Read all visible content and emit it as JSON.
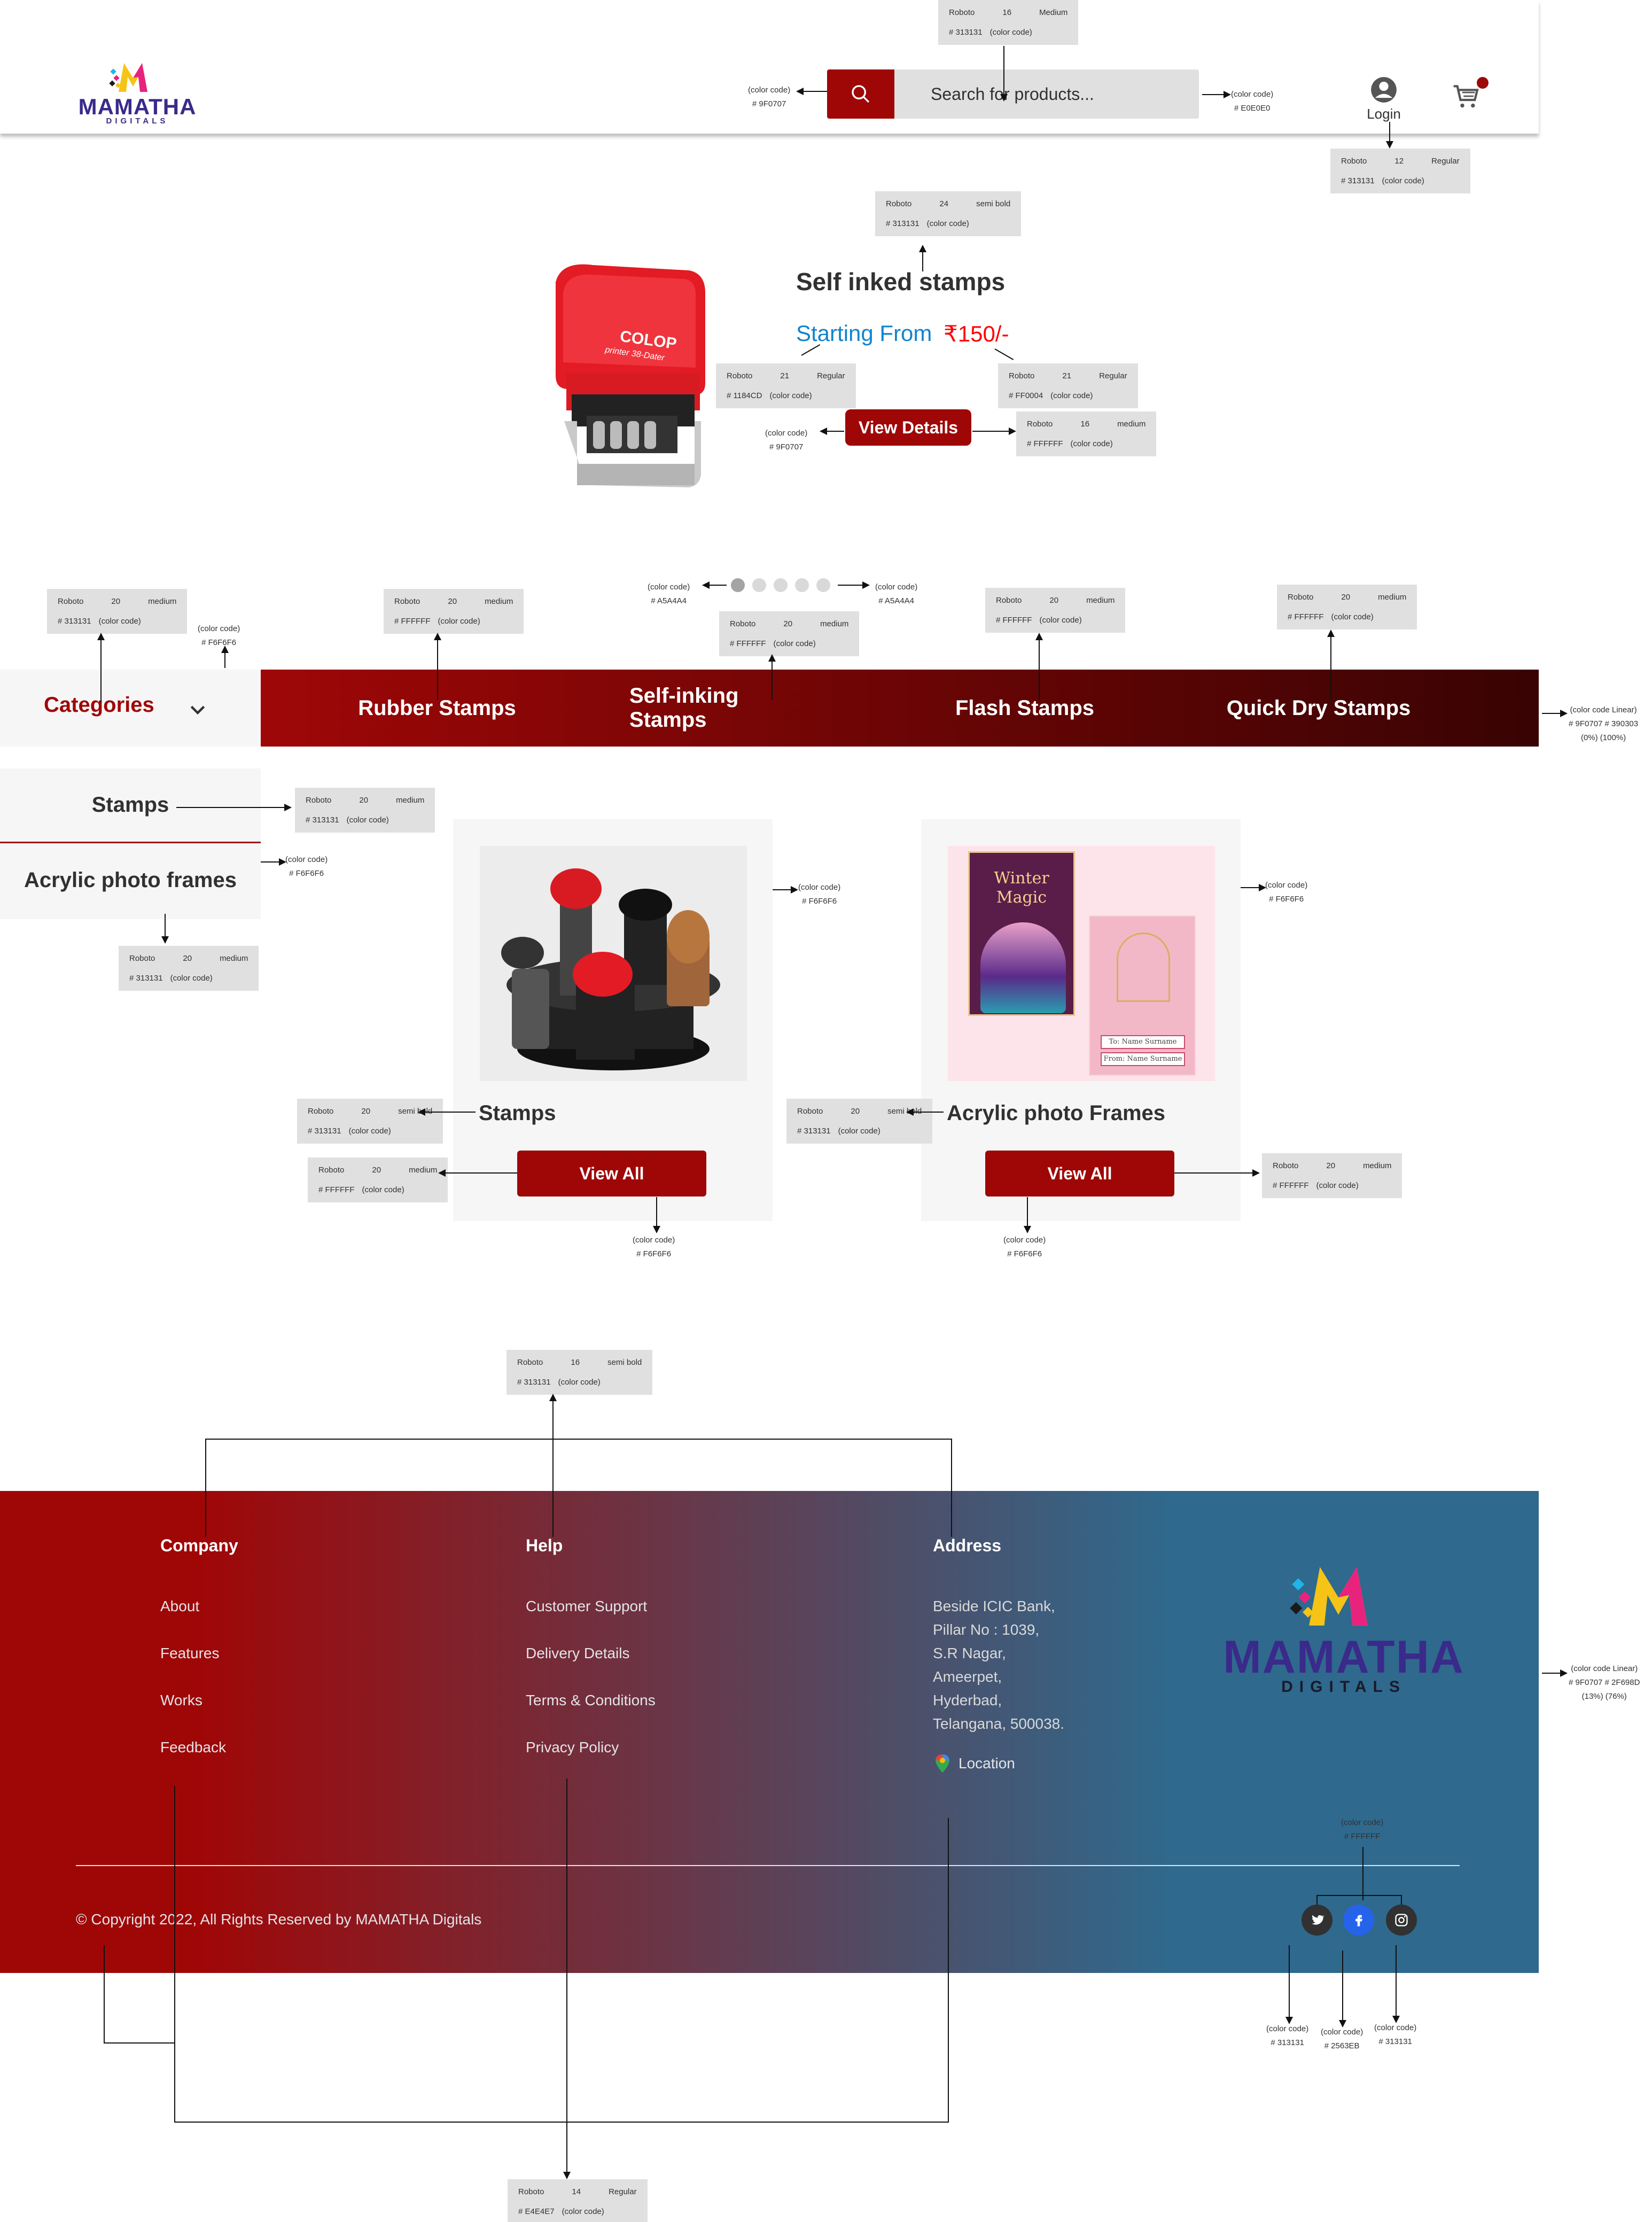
{
  "header": {
    "brand_name": "MAMATHA",
    "brand_sub": "DIGITALS",
    "search_placeholder": "Search for products...",
    "login_label": "Login",
    "cart_badge_color": "#9F0707"
  },
  "hero": {
    "title": "Self inked stamps",
    "starting_label": "Starting From",
    "price": "₹150/-",
    "cta": "View Details",
    "stamp_brand": "COLOP",
    "stamp_model": "printer 38-Dater",
    "carousel_dots": 5,
    "carousel_active": 1
  },
  "nav": {
    "categories_label": "Categories",
    "links": [
      "Rubber Stamps",
      "Self-inking Stamps",
      "Flash Stamps",
      "Quick Dry Stamps"
    ]
  },
  "sidebar": {
    "items": [
      "Stamps",
      "Acrylic photo frames"
    ]
  },
  "products": [
    {
      "title": "Stamps",
      "cta": "View All"
    },
    {
      "title": "Acrylic photo Frames",
      "cta": "View All",
      "card_text_1": "Winter",
      "card_text_2": "Magic",
      "card_line_1": "To: Name Surname",
      "card_line_2": "From: Name Surname"
    }
  ],
  "footer": {
    "company": {
      "title": "Company",
      "links": [
        "About",
        "Features",
        "Works",
        "Feedback"
      ]
    },
    "help": {
      "title": "Help",
      "links": [
        "Customer Support",
        "Delivery Details",
        "Terms & Conditions",
        "Privacy Policy"
      ]
    },
    "address": {
      "title": "Address",
      "lines": [
        "Beside ICIC Bank,",
        "Pillar No : 1039,",
        "S.R Nagar,",
        "Ameerpet,",
        "Hyderbad,",
        "Telangana, 500038."
      ],
      "location_label": "Location"
    },
    "copyright": "© Copyright 2022, All Rights Reserved by MAMATHA Digitals",
    "social_colors": {
      "twitter": "#313131",
      "facebook": "#2563EB",
      "instagram": "#313131"
    }
  },
  "annotations": {
    "t_search_font": {
      "font": "Roboto",
      "size": "16",
      "weight": "Medium",
      "color": "# 313131",
      "suffix": "(color code)"
    },
    "t_login_font": {
      "font": "Roboto",
      "size": "12",
      "weight": "Regular",
      "color": "# 313131",
      "suffix": "(color code)"
    },
    "t_hero_title": {
      "font": "Roboto",
      "size": "24",
      "weight": "semi bold",
      "color": "# 313131",
      "suffix": "(color code)"
    },
    "t_starting": {
      "font": "Roboto",
      "size": "21",
      "weight": "Regular",
      "color": "# 1184CD",
      "suffix": "(color code)"
    },
    "t_price": {
      "font": "Roboto",
      "size": "21",
      "weight": "Regular",
      "color": "# FF0004",
      "suffix": "(color code)"
    },
    "t_viewdetails": {
      "font": "Roboto",
      "size": "16",
      "weight": "medium",
      "color": "# FFFFFF",
      "suffix": "(color code)"
    },
    "t_categories": {
      "font": "Roboto",
      "size": "20",
      "weight": "medium",
      "color": "# 313131",
      "suffix": "(color code)"
    },
    "t_rubber": {
      "font": "Roboto",
      "size": "20",
      "weight": "medium",
      "color": "# FFFFFF",
      "suffix": "(color code)"
    },
    "t_selfink": {
      "font": "Roboto",
      "size": "20",
      "weight": "medium",
      "color": "# FFFFFF",
      "suffix": "(color code)"
    },
    "t_flash": {
      "font": "Roboto",
      "size": "20",
      "weight": "medium",
      "color": "# FFFFFF",
      "suffix": "(color code)"
    },
    "t_quick": {
      "font": "Roboto",
      "size": "20",
      "weight": "medium",
      "color": "# FFFFFF",
      "suffix": "(color code)"
    },
    "t_side_stamps": {
      "font": "Roboto",
      "size": "20",
      "weight": "medium",
      "color": "# 313131",
      "suffix": "(color code)"
    },
    "t_side_acrylic": {
      "font": "Roboto",
      "size": "20",
      "weight": "medium",
      "color": "# 313131",
      "suffix": "(color code)"
    },
    "t_card1_title": {
      "font": "Roboto",
      "size": "20",
      "weight": "semi bold",
      "color": "# 313131",
      "suffix": "(color code)"
    },
    "t_card2_title": {
      "font": "Roboto",
      "size": "20",
      "weight": "semi bold",
      "color": "# 313131",
      "suffix": "(color code)"
    },
    "t_card1_btn": {
      "font": "Roboto",
      "size": "20",
      "weight": "medium",
      "color": "# FFFFFF",
      "suffix": "(color code)"
    },
    "t_card2_btn": {
      "font": "Roboto",
      "size": "20",
      "weight": "medium",
      "color": "# FFFFFF",
      "suffix": "(color code)"
    },
    "t_footer_head": {
      "font": "Roboto",
      "size": "16",
      "weight": "semi bold",
      "color": "# 313131",
      "suffix": "(color code)"
    },
    "t_footer_link": {
      "font": "Roboto",
      "size": "14",
      "weight": "Regular",
      "color": "# E4E4E7",
      "suffix": "(color code)"
    },
    "n_search_btn": [
      "(color code)",
      "# 9F0707"
    ],
    "n_search_box": [
      "(color code)",
      "# E0E0E0"
    ],
    "n_view_details": [
      "(color code)",
      "# 9F0707"
    ],
    "n_cat_bg": [
      "(color code)",
      "# F6F6F6"
    ],
    "n_dots_left": [
      "(color code)",
      "# A5A4A4"
    ],
    "n_dots_right": [
      "(color code)",
      "# A5A4A4"
    ],
    "n_catbar": [
      "(color code Linear)",
      "# 9F0707    # 390303",
      "(0%)          (100%)"
    ],
    "n_side_bg": [
      "(color code)",
      "# F6F6F6"
    ],
    "n_card1_bg": [
      "(color code)",
      "# F6F6F6"
    ],
    "n_card2_bg": [
      "(color code)",
      "# F6F6F6"
    ],
    "n_card1_bottom": [
      "(color code)",
      "# F6F6F6"
    ],
    "n_card2_bottom": [
      "(color code)",
      "# F6F6F6"
    ],
    "n_footer": [
      "(color code Linear)",
      "# 9F0707    # 2F698D",
      "(13%)          (76%)"
    ],
    "n_social_icon": [
      "(color code)",
      "# FFFFFF"
    ],
    "n_twitter": [
      "(color code)",
      "# 313131"
    ],
    "n_facebook": [
      "(color code)",
      "# 2563EB"
    ],
    "n_instagram": [
      "(color code)",
      "# 313131"
    ]
  }
}
